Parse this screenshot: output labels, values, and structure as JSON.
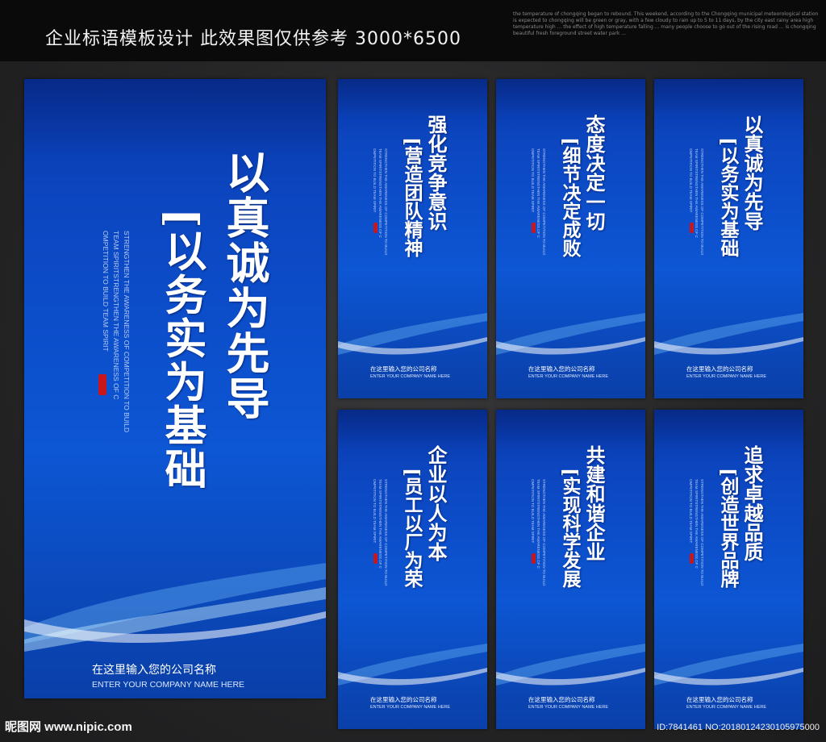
{
  "header": {
    "title": "企业标语模板设计  此效果图仅供参考 3000*6500",
    "note": "the temperature of chongqing began to rebound. This weekend, according to the Chongqing municipal meteorological station is expected to chongqing will be green or gray, with a few cloudy to rain up to 5 to 11 days, by the city east rainy area high temperature high ... the effect of high temperature falling ... many people choose to go out of the rising road ... is chongqing beautiful fresh foreground street water park ..."
  },
  "posters": [
    {
      "main": "以真诚为先导",
      "sub": "[以务实为基础",
      "en_lines": [
        "STRENGTHEN THE AWARENESS OF COMPETITION TO BUILD",
        "TEAM SPIRITSTRENGTHEN THE AWARENESS OF C",
        "OMPETITION TO BUILD TEAM SPIRIT"
      ],
      "company": "在这里输入您的公司名称",
      "company_en": "ENTER YOUR COMPANY NAME HERE"
    },
    {
      "main": "强化竞争意识",
      "sub": "[营造团队精神",
      "en_lines": [
        "STRENGTHEN THE AWARENESS OF COMPETITION TO BUILD",
        "TEAM SPIRITSTRENGTHEN THE AWARENESS OF C",
        "OMPETITION TO BUILD TEAM SPIRIT"
      ],
      "company": "在这里输入您的公司名称",
      "company_en": "ENTER YOUR COMPANY NAME HERE"
    },
    {
      "main": "态度决定一切",
      "sub": "[细节决定成败",
      "en_lines": [
        "STRENGTHEN THE AWARENESS OF COMPETITION TO BUILD",
        "TEAM SPIRITSTRENGTHEN THE AWARENESS OF C",
        "OMPETITION TO BUILD TEAM SPIRIT"
      ],
      "company": "在这里输入您的公司名称",
      "company_en": "ENTER YOUR COMPANY NAME HERE"
    },
    {
      "main": "以真诚为先导",
      "sub": "[以务实为基础",
      "en_lines": [
        "STRENGTHEN THE AWARENESS OF COMPETITION TO BUILD",
        "TEAM SPIRITSTRENGTHEN THE AWARENESS OF C",
        "OMPETITION TO BUILD TEAM SPIRIT"
      ],
      "company": "在这里输入您的公司名称",
      "company_en": "ENTER YOUR COMPANY NAME HERE"
    },
    {
      "main": "企业以人为本",
      "sub": "[员工以厂为荣",
      "en_lines": [
        "STRENGTHEN THE AWARENESS OF COMPETITION TO BUILD",
        "TEAM SPIRITSTRENGTHEN THE AWARENESS OF C",
        "OMPETITION TO BUILD TEAM SPIRIT"
      ],
      "company": "在这里输入您的公司名称",
      "company_en": "ENTER YOUR COMPANY NAME HERE"
    },
    {
      "main": "共建和谐企业",
      "sub": "[实现科学发展",
      "en_lines": [
        "STRENGTHEN THE AWARENESS OF COMPETITION TO BUILD",
        "TEAM SPIRITSTRENGTHEN THE AWARENESS OF C",
        "OMPETITION TO BUILD TEAM SPIRIT"
      ],
      "company": "在这里输入您的公司名称",
      "company_en": "ENTER YOUR COMPANY NAME HERE"
    },
    {
      "main": "追求卓越品质",
      "sub": "[创造世界品牌",
      "en_lines": [
        "STRENGTHEN THE AWARENESS OF COMPETITION TO BUILD",
        "TEAM SPIRITSTRENGTHEN THE AWARENESS OF C",
        "OMPETITION TO BUILD TEAM SPIRIT"
      ],
      "company": "在这里输入您的公司名称",
      "company_en": "ENTER YOUR COMPANY NAME HERE"
    }
  ],
  "footer": {
    "logo": "昵图网 www.nipic.com",
    "id": "ID:7841461 NO:20180124230105975000"
  },
  "colors": {
    "poster_blue": "#0c4cc8",
    "seal_red": "#c8161d",
    "topbar": "#0a0a0a"
  }
}
